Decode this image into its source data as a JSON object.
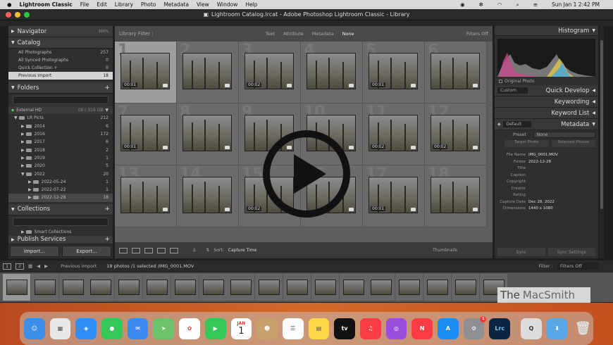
{
  "menubar": {
    "app": "Lightroom Classic",
    "items": [
      "File",
      "Edit",
      "Library",
      "Photo",
      "Metadata",
      "View",
      "Window",
      "Help"
    ],
    "clock": "Sun Jan 1  2:42 PM"
  },
  "window": {
    "title": "Lightroom Catalog.lrcat - Adobe Photoshop Lightroom Classic - Library"
  },
  "navigator": {
    "title": "Navigator",
    "zoom": "100%"
  },
  "catalog": {
    "title": "Catalog",
    "items": [
      {
        "label": "All Photographs",
        "count": "257"
      },
      {
        "label": "All Synced Photographs",
        "count": "0"
      },
      {
        "label": "Quick Collection +",
        "count": "0"
      },
      {
        "label": "Previous Import",
        "count": "18"
      }
    ]
  },
  "folders": {
    "title": "Folders",
    "drive": "External HD",
    "drive_size": "00 / 316 GB",
    "items": [
      {
        "label": "LR Picts",
        "count": "212"
      },
      {
        "label": "2014",
        "count": "6"
      },
      {
        "label": "2016",
        "count": "172"
      },
      {
        "label": "2017",
        "count": "6"
      },
      {
        "label": "2018",
        "count": "2"
      },
      {
        "label": "2019",
        "count": "1"
      },
      {
        "label": "2020",
        "count": "5"
      },
      {
        "label": "2022",
        "count": "20"
      },
      {
        "label": "2022-05-24",
        "count": "1"
      },
      {
        "label": "2022-07-22",
        "count": "1"
      },
      {
        "label": "2022-12-28",
        "count": "18"
      }
    ]
  },
  "collections": {
    "title": "Collections",
    "smart": "Smart Collections"
  },
  "publish": {
    "title": "Publish Services"
  },
  "buttons": {
    "import": "Import...",
    "export": "Export..."
  },
  "filter": {
    "label": "Library Filter :",
    "options": [
      "Text",
      "Attribute",
      "Metadata",
      "None"
    ],
    "filters_off": "Filters Off"
  },
  "grid": {
    "durations": [
      "00:01",
      "",
      "00:02",
      "",
      "00:01",
      "",
      "00:01",
      "",
      "",
      "",
      "00:02",
      "00:02",
      "",
      "",
      "00:02",
      "",
      "00:01",
      ""
    ],
    "numbers": [
      "1",
      "2",
      "3",
      "4",
      "5",
      "6",
      "7",
      "8",
      "9",
      "10",
      "11",
      "12",
      "13",
      "14",
      "15",
      "16",
      "17",
      "18"
    ]
  },
  "toolbar": {
    "sort_label": "Sort:",
    "sort_value": "Capture Time",
    "thumbnails": "Thumbnails"
  },
  "right": {
    "histogram": "Histogram",
    "original": "Original Photo",
    "custom": "Custom",
    "quick_develop": "Quick Develop",
    "keywording": "Keywording",
    "keyword_list": "Keyword List",
    "default": "Default",
    "metadata": "Metadata",
    "preset_label": "Preset",
    "preset_value": "None",
    "target": "Target Photo",
    "selected": "Selected Photos"
  },
  "meta": [
    {
      "k": "File Name",
      "v": "IMG_0001.MOV"
    },
    {
      "k": "Folder",
      "v": "2022-12-28"
    },
    {
      "k": "Title",
      "v": ""
    },
    {
      "k": "Caption",
      "v": ""
    },
    {
      "k": "Copyright",
      "v": ""
    },
    {
      "k": "Creator",
      "v": ""
    },
    {
      "k": "Rating",
      "v": ""
    },
    {
      "k": "Capture Date",
      "v": "Dec 28, 2022"
    },
    {
      "k": "Dimensions",
      "v": "1440 x 1080"
    }
  ],
  "sync": {
    "meta": "Sync",
    "settings": "Sync Settings"
  },
  "filmstrip": {
    "p1": "1",
    "p2": "2",
    "source": "Previous Import",
    "count": "18 photos /1 selected /IMG_0001.MOV",
    "filter": "Filter :",
    "filter_value": "Filters Off"
  },
  "watermark": {
    "a": "The",
    "b": "MacSmith"
  },
  "dock": [
    "Finder",
    "Launchpad",
    "Safari",
    "Messages",
    "Mail",
    "Maps",
    "Photos",
    "FaceTime",
    "Calendar",
    "Contacts",
    "Reminders",
    "Notes",
    "TV",
    "Music",
    "Podcasts",
    "News",
    "App Store",
    "System Preferences",
    "Lightroom Classic",
    "QuickTime",
    "Downloads",
    "Trash"
  ],
  "calendar": {
    "month": "JAN",
    "day": "1"
  }
}
